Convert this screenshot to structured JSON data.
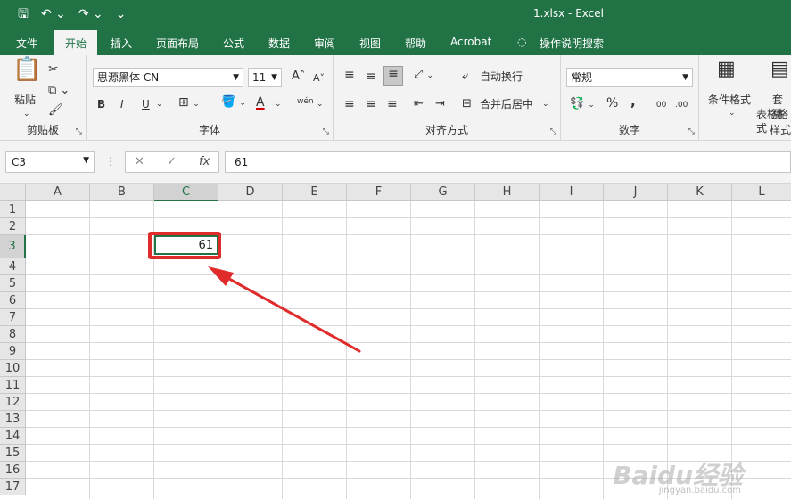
{
  "window": {
    "title": "1.xlsx  -  Excel"
  },
  "qat": {
    "save": "save",
    "undo": "undo",
    "redo": "redo",
    "more": "⌄"
  },
  "tabs": [
    "文件",
    "开始",
    "插入",
    "页面布局",
    "公式",
    "数据",
    "审阅",
    "视图",
    "帮助",
    "Acrobat",
    "操作说明搜索"
  ],
  "ribbon": {
    "clipboard": {
      "paste": "粘贴",
      "label": "剪贴板"
    },
    "font": {
      "name": "思源黑体 CN",
      "size": "11",
      "label": "字体",
      "bold": "B",
      "italic": "I",
      "underline": "U",
      "grow": "A",
      "shrink": "A",
      "phonetic": "wén",
      "font_color": "A"
    },
    "alignment": {
      "wrap": "自动换行",
      "merge": "合并后居中",
      "label": "对齐方式"
    },
    "number": {
      "format": "常规",
      "label": "数字",
      "percent": "%",
      "comma": ",",
      "inc_decimal": ".00",
      "dec_decimal": ".00"
    },
    "styles": {
      "conditional": "条件格式",
      "table_line1": "套用",
      "table_line2": "表格格式",
      "label": "样式"
    }
  },
  "formula_bar": {
    "name_box": "C3",
    "fx": "fx",
    "value": "61"
  },
  "sheet": {
    "columns": [
      "A",
      "B",
      "C",
      "D",
      "E",
      "F",
      "G",
      "H",
      "I",
      "J",
      "K",
      "L"
    ],
    "rows": [
      "1",
      "2",
      "3",
      "4",
      "5",
      "6",
      "7",
      "8",
      "9",
      "10",
      "11",
      "12",
      "13",
      "14",
      "15",
      "16",
      "17"
    ],
    "cell_c3": "61"
  },
  "watermark": {
    "brand": "Baidu经验",
    "url": "jingyan.baidu.com"
  },
  "colors": {
    "excel_green": "#217346",
    "highlight_red": "#e02b2b"
  }
}
